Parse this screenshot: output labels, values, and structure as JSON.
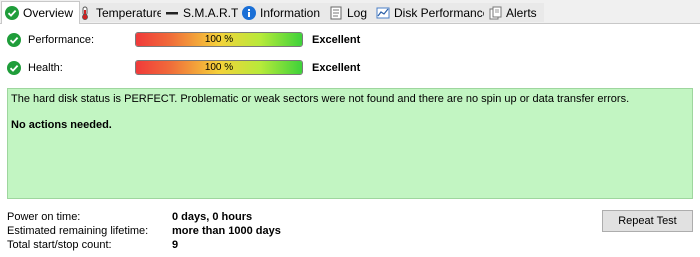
{
  "tabs": [
    {
      "label": "Overview",
      "icon": "check-circle-icon",
      "active": true
    },
    {
      "label": "Temperature",
      "icon": "thermometer-icon",
      "active": false
    },
    {
      "label": "S.M.A.R.T.",
      "icon": "dash-icon",
      "active": false
    },
    {
      "label": "Information",
      "icon": "info-icon",
      "active": false
    },
    {
      "label": "Log",
      "icon": "log-icon",
      "active": false
    },
    {
      "label": "Disk Performance",
      "icon": "chart-icon",
      "active": false
    },
    {
      "label": "Alerts",
      "icon": "alerts-icon",
      "active": false
    }
  ],
  "status": {
    "performance": {
      "label": "Performance:",
      "value_text": "100 %",
      "percent": 100,
      "rating": "Excellent"
    },
    "health": {
      "label": "Health:",
      "value_text": "100 %",
      "percent": 100,
      "rating": "Excellent"
    }
  },
  "message": {
    "line1": "The hard disk status is PERFECT. Problematic or weak sectors were not found and there are no spin up or data transfer errors.",
    "line2": "No actions needed."
  },
  "info": {
    "power_on_label": "Power on time:",
    "power_on_value": "0 days, 0 hours",
    "lifetime_label": "Estimated remaining lifetime:",
    "lifetime_value": "more than 1000 days",
    "startstop_label": "Total start/stop count:",
    "startstop_value": "9"
  },
  "buttons": {
    "repeat_test": "Repeat Test"
  },
  "colors": {
    "ok_green": "#1f9d3a",
    "panel_bg": "#c2f5c2",
    "info_blue": "#1a6fd6"
  }
}
